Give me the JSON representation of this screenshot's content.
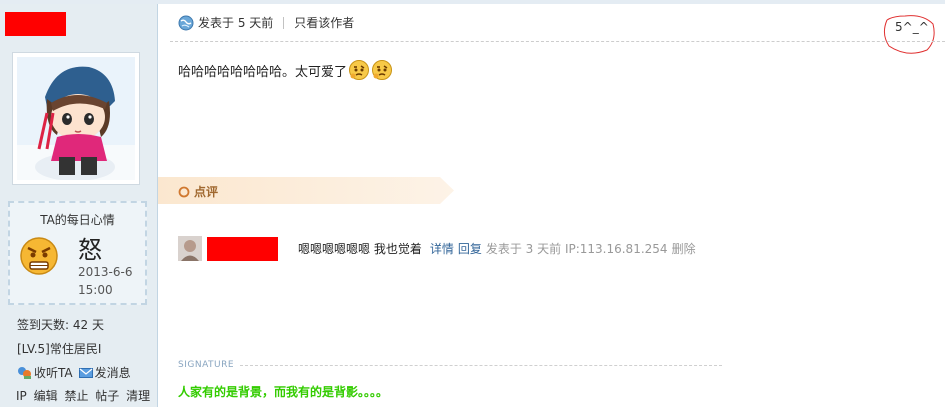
{
  "sidebar": {
    "mood": {
      "title": "TA的每日心情",
      "word": "怒",
      "date": "2013-6-6",
      "time": "15:00"
    },
    "sign_days": "签到天数: 42 天",
    "level": "[LV.5]常住居民I",
    "follow_label": "收听TA",
    "message_label": "发消息",
    "admin": [
      "IP",
      "编辑",
      "禁止",
      "帖子",
      "清理"
    ]
  },
  "post": {
    "posted": "发表于 5 天前",
    "author_only": "只看该作者",
    "floor": "5^_^",
    "content": "哈哈哈哈哈哈哈哈。太可爱了"
  },
  "comments": {
    "label": "点评",
    "items": [
      {
        "text": "嗯嗯嗯嗯嗯嗯 我也觉着",
        "detail": "详情",
        "reply": "回复",
        "meta": "发表于 3 天前 IP:113.16.81.254",
        "delete": "删除"
      }
    ]
  },
  "signature": {
    "label": "SIGNATURE",
    "text": "人家有的是背景，而我有的是背影。。。。"
  },
  "colors": {
    "redaction": "#ff0000",
    "sidebar_bg": "#e5edf2",
    "link": "#336699",
    "signature": "#33cc00",
    "comment_label": "#a0682f"
  }
}
